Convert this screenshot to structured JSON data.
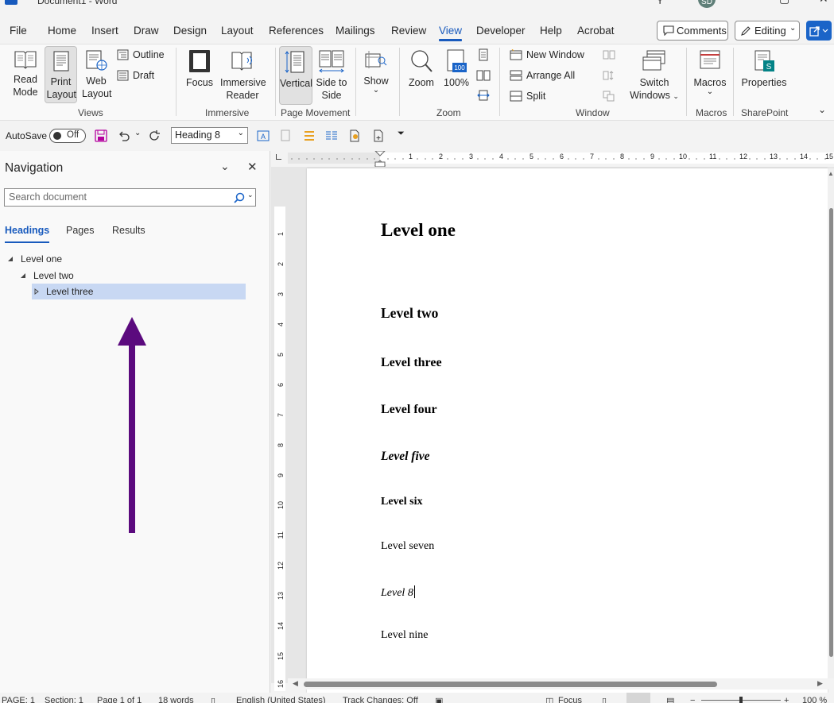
{
  "window": {
    "title": "Document1 - Word",
    "user_initials": "SD"
  },
  "menu": {
    "tabs": [
      "File",
      "Home",
      "Insert",
      "Draw",
      "Design",
      "Layout",
      "References",
      "Mailings",
      "Review",
      "View",
      "Developer",
      "Help",
      "Acrobat"
    ],
    "active": "View",
    "comments_label": "Comments",
    "editing_label": "Editing"
  },
  "ribbon": {
    "views": {
      "read_mode": "Read Mode",
      "print_layout": "Print Layout",
      "web_layout": "Web Layout",
      "outline": "Outline",
      "draft": "Draft",
      "group": "Views"
    },
    "immersive": {
      "focus": "Focus",
      "immersive_reader": "Immersive Reader",
      "group": "Immersive"
    },
    "page_movement": {
      "vertical": "Vertical",
      "side_to_side": "Side to Side",
      "group": "Page Movement"
    },
    "show": {
      "label": "Show"
    },
    "zoom": {
      "zoom": "Zoom",
      "hundred": "100%",
      "icon_text": "100",
      "group": "Zoom"
    },
    "window": {
      "new_window": "New Window",
      "arrange_all": "Arrange All",
      "split": "Split",
      "switch_windows": "Switch Windows",
      "group": "Window"
    },
    "macros": {
      "label": "Macros",
      "group": "Macros"
    },
    "sharepoint": {
      "properties": "Properties",
      "group": "SharePoint"
    }
  },
  "qat": {
    "autosave_label": "AutoSave",
    "toggle_state": "Off",
    "style_value": "Heading 8"
  },
  "navigation": {
    "title": "Navigation",
    "search_placeholder": "Search document",
    "tabs": [
      "Headings",
      "Pages",
      "Results"
    ],
    "active_tab": "Headings",
    "tree": [
      {
        "label": "Level one",
        "depth": 0,
        "expanded": true,
        "selected": false
      },
      {
        "label": "Level two",
        "depth": 1,
        "expanded": true,
        "selected": false
      },
      {
        "label": "Level three",
        "depth": 2,
        "expanded": false,
        "selected": true
      }
    ]
  },
  "annotation": {
    "arrow_color": "#5b0a7e",
    "arrow_direction": "up"
  },
  "document": {
    "headings": [
      {
        "text": "Level one",
        "style": "h1"
      },
      {
        "text": "Level two",
        "style": "h2"
      },
      {
        "text": "Level three",
        "style": "h3"
      },
      {
        "text": "Level four",
        "style": "h4"
      },
      {
        "text": "Level five",
        "style": "h5"
      },
      {
        "text": "Level six",
        "style": "h6"
      },
      {
        "text": "Level seven",
        "style": "h7"
      },
      {
        "text": "Level 8",
        "style": "h8"
      },
      {
        "text": "Level nine",
        "style": "h9"
      }
    ],
    "ruler_h": [
      "1",
      "2",
      "3",
      "4",
      "5",
      "6",
      "7",
      "8",
      "9",
      "10",
      "11",
      "12",
      "13",
      "14",
      "15"
    ],
    "ruler_v": [
      "1",
      "2",
      "3",
      "4",
      "5",
      "6",
      "7",
      "8",
      "9",
      "10",
      "11",
      "12",
      "13",
      "14",
      "15",
      "16"
    ]
  },
  "status": {
    "page": "PAGE: 1",
    "section": "Section: 1",
    "page_of": "Page 1 of 1",
    "words": "18 words",
    "language": "English (United States)",
    "track_changes": "Track Changes: Off",
    "focus": "Focus",
    "zoom": "100 %"
  },
  "colors": {
    "accent": "#185abd",
    "selection": "#c8d8f3"
  }
}
